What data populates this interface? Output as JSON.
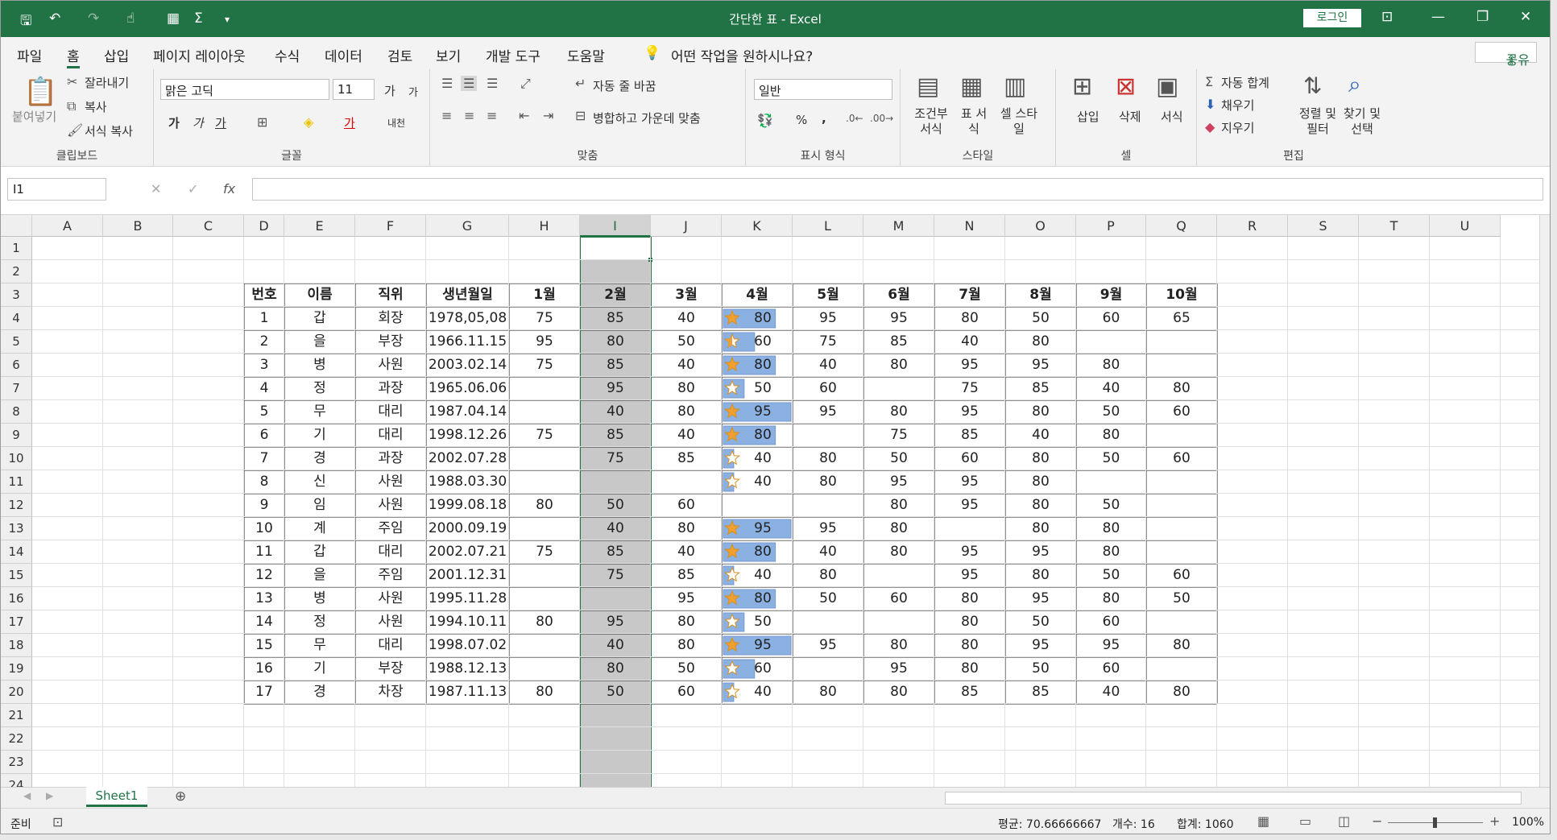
{
  "window": {
    "title": "간단한 표 - Excel",
    "login": "로그인"
  },
  "tabs": [
    "파일",
    "홈",
    "삽입",
    "페이지 레이아웃",
    "수식",
    "데이터",
    "검토",
    "보기",
    "개발 도구",
    "도움말"
  ],
  "active_tab": "홈",
  "tell_me": "어떤 작업을 원하시나요?",
  "share": "공유",
  "ribbon": {
    "clipboard": {
      "label": "클립보드",
      "paste": "붙여넣기",
      "cut": "잘라내기",
      "copy": "복사",
      "format_painter": "서식 복사"
    },
    "font": {
      "label": "글꼴",
      "name": "맑은 고딕",
      "size": "11",
      "bold": "가",
      "italic": "가",
      "underline": "가",
      "grow": "가",
      "shrink": "가",
      "color_char": "가",
      "phonetic": "내천"
    },
    "alignment": {
      "label": "맞춤",
      "wrap": "자동 줄 바꿈",
      "merge": "병합하고 가운데 맞춤"
    },
    "number": {
      "label": "표시 형식",
      "format": "일반",
      "percent": "%",
      "comma": ","
    },
    "styles": {
      "label": "스타일",
      "conditional": "조건부 서식",
      "table": "표 서식",
      "cell": "셀 스타일"
    },
    "cells": {
      "label": "셀",
      "insert": "삽입",
      "delete": "삭제",
      "format": "서식"
    },
    "editing": {
      "label": "편집",
      "autosum": "자동 합계",
      "fill": "채우기",
      "clear": "지우기",
      "sort": "정렬 및 필터",
      "find": "찾기 및 선택"
    }
  },
  "name_box": "I1",
  "fx_label": "fx",
  "columns": [
    "A",
    "B",
    "C",
    "D",
    "E",
    "F",
    "G",
    "H",
    "I",
    "J",
    "K",
    "L",
    "M",
    "N",
    "O",
    "P",
    "Q",
    "R",
    "S",
    "T",
    "U"
  ],
  "selected_column": "I",
  "rows": [
    "1",
    "2",
    "3",
    "4",
    "5",
    "6",
    "7",
    "8",
    "9",
    "10",
    "11",
    "12",
    "13",
    "14",
    "15",
    "16",
    "17",
    "18",
    "19",
    "20",
    "21",
    "22",
    "23",
    "24"
  ],
  "table": {
    "headers": [
      "번호",
      "이름",
      "직위",
      "생년월일",
      "1월",
      "2월",
      "3월",
      "4월",
      "5월",
      "6월",
      "7월",
      "8월",
      "9월",
      "10월"
    ],
    "rows": [
      [
        "1",
        "갑",
        "회장",
        "1978,05,08",
        "75",
        "85",
        "40",
        "80",
        "95",
        "95",
        "80",
        "50",
        "60",
        "65"
      ],
      [
        "2",
        "을",
        "부장",
        "1966.11.15",
        "95",
        "80",
        "50",
        "60",
        "75",
        "85",
        "40",
        "80",
        "",
        ""
      ],
      [
        "3",
        "병",
        "사원",
        "2003.02.14",
        "75",
        "85",
        "40",
        "80",
        "40",
        "80",
        "95",
        "95",
        "80",
        ""
      ],
      [
        "4",
        "정",
        "과장",
        "1965.06.06",
        "",
        "95",
        "80",
        "50",
        "60",
        "",
        "75",
        "85",
        "40",
        "80"
      ],
      [
        "5",
        "무",
        "대리",
        "1987.04.14",
        "",
        "40",
        "80",
        "95",
        "95",
        "80",
        "95",
        "80",
        "50",
        "60"
      ],
      [
        "6",
        "기",
        "대리",
        "1998.12.26",
        "75",
        "85",
        "40",
        "80",
        "",
        "75",
        "85",
        "40",
        "80",
        ""
      ],
      [
        "7",
        "경",
        "과장",
        "2002.07.28",
        "",
        "75",
        "85",
        "40",
        "80",
        "50",
        "60",
        "80",
        "50",
        "60"
      ],
      [
        "8",
        "신",
        "사원",
        "1988.03.30",
        "",
        "",
        "",
        "40",
        "80",
        "95",
        "95",
        "80",
        "",
        ""
      ],
      [
        "9",
        "임",
        "사원",
        "1999.08.18",
        "80",
        "50",
        "60",
        "",
        "",
        "80",
        "95",
        "80",
        "50",
        ""
      ],
      [
        "10",
        "계",
        "주임",
        "2000.09.19",
        "",
        "40",
        "80",
        "95",
        "95",
        "80",
        "",
        "80",
        "80",
        ""
      ],
      [
        "11",
        "갑",
        "대리",
        "2002.07.21",
        "75",
        "85",
        "40",
        "80",
        "40",
        "80",
        "95",
        "95",
        "80",
        ""
      ],
      [
        "12",
        "을",
        "주임",
        "2001.12.31",
        "",
        "75",
        "85",
        "40",
        "80",
        "",
        "95",
        "80",
        "50",
        "60"
      ],
      [
        "13",
        "병",
        "사원",
        "1995.11.28",
        "",
        "",
        "95",
        "80",
        "50",
        "60",
        "80",
        "95",
        "80",
        "50"
      ],
      [
        "14",
        "정",
        "사원",
        "1994.10.11",
        "80",
        "95",
        "80",
        "50",
        "",
        "",
        "80",
        "50",
        "60",
        ""
      ],
      [
        "15",
        "무",
        "대리",
        "1998.07.02",
        "",
        "40",
        "80",
        "95",
        "95",
        "80",
        "80",
        "95",
        "95",
        "80"
      ],
      [
        "16",
        "기",
        "부장",
        "1988.12.13",
        "",
        "80",
        "50",
        "60",
        "",
        "95",
        "80",
        "50",
        "60",
        ""
      ],
      [
        "17",
        "경",
        "차장",
        "1987.11.13",
        "80",
        "50",
        "60",
        "40",
        "80",
        "80",
        "85",
        "85",
        "40",
        "80"
      ]
    ]
  },
  "k_icon_sets": [
    "full",
    "half",
    "full",
    "empty",
    "full",
    "full",
    "empty",
    "empty",
    "",
    "full",
    "full",
    "empty",
    "full",
    "empty",
    "full",
    "empty",
    "empty"
  ],
  "sheet_tab": "Sheet1",
  "status": {
    "ready": "준비",
    "average": "평균: 70.66666667",
    "count": "개수: 16",
    "sum": "합계: 1060",
    "zoom": "100%"
  },
  "colors": {
    "accent": "#217346",
    "selection_fill": "#c8c8c8",
    "databar": "#5b8fd6",
    "star": "#f0a030"
  }
}
